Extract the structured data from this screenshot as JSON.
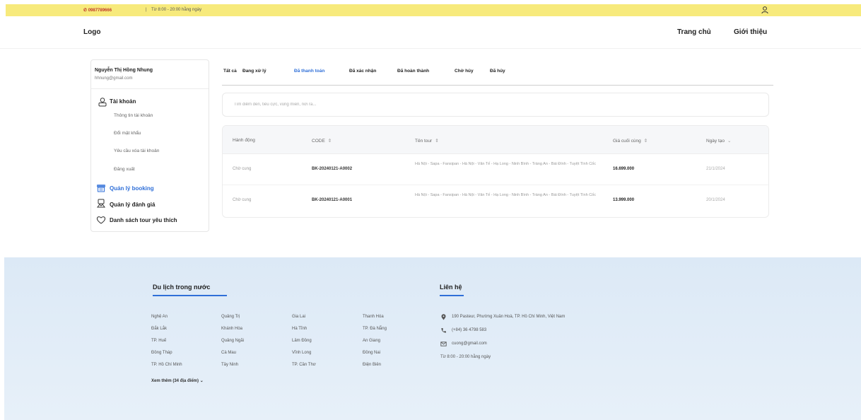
{
  "topbar": {
    "phone": "0987789666",
    "separator": "|",
    "hours": "Từ 8:00 - 20:00 hằng ngày"
  },
  "header": {
    "logo": "Logo",
    "nav": {
      "home": "Trang chủ",
      "about": "Giới thiệu"
    }
  },
  "sidebar": {
    "user_name": "Nguyễn Thị Hồng Nhung",
    "user_email": "hhnung@gmail.com",
    "account": {
      "label": "Tài khoản",
      "items": [
        "Thông tin tài khoản",
        "Đổi mật khẩu",
        "Yêu cầu xóa tài khoản",
        "Đăng xuất"
      ]
    },
    "booking": "Quản lý booking",
    "reviews": "Quản lý đánh giá",
    "wishlist": "Danh sách tour yêu thích"
  },
  "tabs": [
    "Tất cả",
    "Đang xử lý",
    "Đã thanh toán",
    "Đã xác nhận",
    "Đã hoàn thành",
    "Chờ hủy",
    "Đã hủy"
  ],
  "active_tab": "Đã thanh toán",
  "search": {
    "placeholder": "Tìm điểm đến, tiêu cực, vùng miền, nơi ra..."
  },
  "table": {
    "headers": {
      "action": "Hành động",
      "code": "CODE",
      "tour": "Tên tour",
      "price": "Giá cuối cùng",
      "date": "Ngày tạo"
    },
    "rows": [
      {
        "action": "Chờ cung",
        "code": "BK-20240121-A0002",
        "tour": "Hà Nội - Sapa - Fansipan - Hà Nội - Vân Tế - Hạ Long - Ninh Bình - Tràng An - Bái Đính - Tuyệt Tình Cốc",
        "price": "16.699.000",
        "date": "21/1/2024"
      },
      {
        "action": "Chờ cung",
        "code": "BK-20240121-A0001",
        "tour": "Hà Nội - Sapa - Fansipan - Hà Nội - Vân Tế - Hạ Long - Ninh Bình - Tràng An - Bái Đính - Tuyệt Tình Cốc",
        "price": "13.999.000",
        "date": "20/1/2024"
      }
    ]
  },
  "footer": {
    "domestic_title": "Du lịch trong nước",
    "columns": [
      [
        "Nghệ An",
        "Đắk Lắk",
        "TP. Huế",
        "Đồng Tháp",
        "TP. Hồ Chí Minh"
      ],
      [
        "Quảng Trị",
        "Khánh Hòa",
        "Quảng Ngãi",
        "Cà Mau",
        "Tây Ninh"
      ],
      [
        "Gia Lai",
        "Hà Tĩnh",
        "Lâm Đồng",
        "Vĩnh Long",
        "TP. Cần Thơ"
      ],
      [
        "Thanh Hóa",
        "TP. Đà Nẵng",
        "An Giang",
        "Đồng Nai",
        "Điện Biên"
      ]
    ],
    "more": "Xem thêm (34 địa điểm)",
    "contact_title": "Liên hệ",
    "contact": {
      "address": "190 Pasteur, Phường Xuân Hoà, TP. Hồ Chí Minh, Việt Nam",
      "phone": "(+84) 36 4798 583",
      "email": "cuong@gmail.com",
      "hours": "Từ 8:00 - 20:00 hằng ngày"
    }
  },
  "colors": {
    "topbar": "#f7ea7c",
    "accent": "#2f6fd8",
    "footer_bg": "#dce9f6"
  },
  "icons": [
    "phone-icon",
    "user-icon",
    "account-icon",
    "booking-icon",
    "review-icon",
    "heart-icon",
    "sort-icon",
    "chevron-down-icon",
    "location-icon",
    "mail-icon"
  ]
}
